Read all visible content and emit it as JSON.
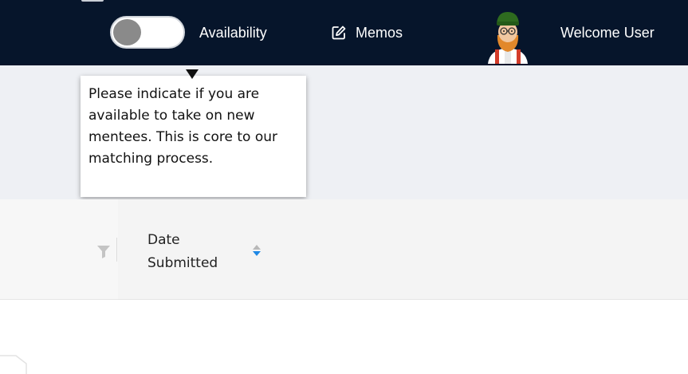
{
  "navbar": {
    "availability_label": "Availability",
    "availability_on": false,
    "memos_label": "Memos",
    "memos_icon": "edit-icon",
    "welcome_label": "Welcome User",
    "avatar_icon": "user-avatar-icon"
  },
  "tooltip": {
    "text": "Please indicate if you are available to take on new mentees. This is core to our matching process."
  },
  "table": {
    "filter_icon": "filter-icon",
    "date_column_title": "Date Submitted",
    "sort_icon": "sort-icon"
  },
  "colors": {
    "navbar_bg": "#06152b",
    "band_bg": "#eef0f4",
    "sort_active": "#1e88e5",
    "toggle_knob": "#8a8a8a"
  }
}
